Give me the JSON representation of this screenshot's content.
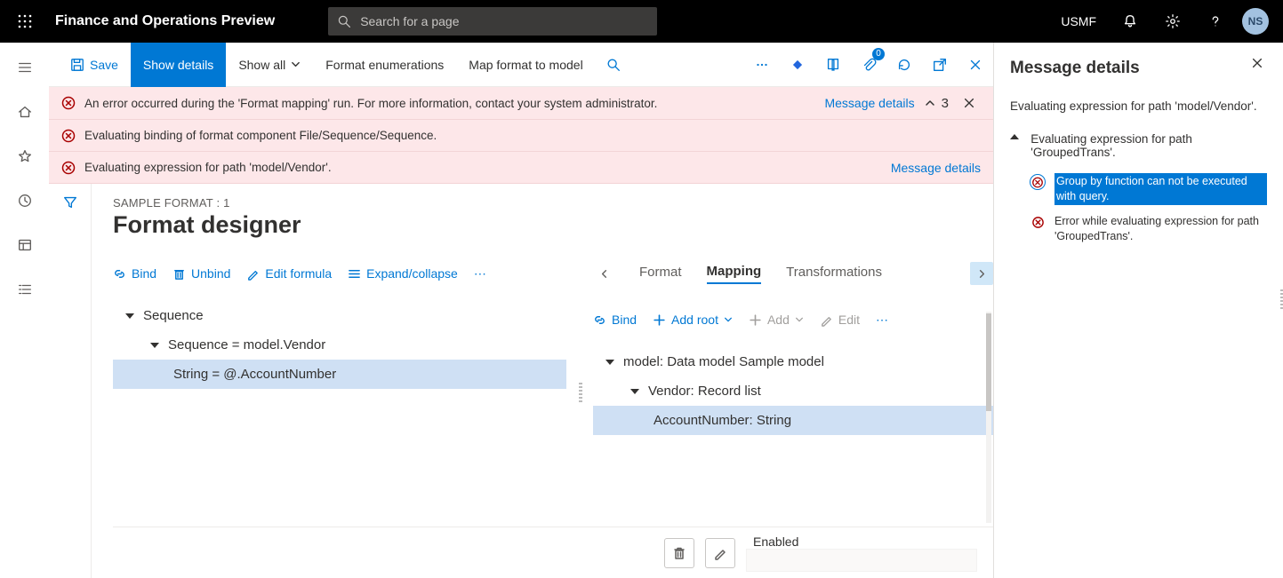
{
  "appbar": {
    "title": "Finance and Operations Preview",
    "search_placeholder": "Search for a page",
    "company": "USMF",
    "avatar": "NS"
  },
  "actionbar": {
    "save": "Save",
    "show_details": "Show details",
    "show_all": "Show all",
    "format_enum": "Format enumerations",
    "map_format": "Map format to model",
    "attach_badge": "0"
  },
  "errors": {
    "e1": "An error occurred during the 'Format mapping' run. For more information, contact your system administrator.",
    "e2": "Evaluating binding of format component File/Sequence/Sequence.",
    "e3": "Evaluating expression for path 'model/Vendor'.",
    "msg_details": "Message details",
    "count": "3"
  },
  "designer": {
    "breadcrumb": "SAMPLE FORMAT : 1",
    "title": "Format designer",
    "cmd_bind": "Bind",
    "cmd_unbind": "Unbind",
    "cmd_edit_formula": "Edit formula",
    "cmd_expand": "Expand/collapse",
    "tree_left": {
      "n1": "Sequence",
      "n2": "Sequence = model.Vendor",
      "n3": "String = @.AccountNumber"
    },
    "tabs": {
      "format": "Format",
      "mapping": "Mapping",
      "transformations": "Transformations"
    },
    "cmd_bind_r": "Bind",
    "cmd_add_root": "Add root",
    "cmd_add": "Add",
    "cmd_edit": "Edit",
    "tree_right": {
      "n1": "model: Data model Sample model",
      "n2": "Vendor: Record list",
      "n3": "AccountNumber: String"
    },
    "enabled": "Enabled"
  },
  "msgpanel": {
    "title": "Message details",
    "subtitle": "Evaluating expression for path 'model/Vendor'.",
    "group": "Evaluating expression for path 'GroupedTrans'.",
    "items": {
      "i1": "Group by function can not be executed with query.",
      "i2": "Error while evaluating expression for path 'GroupedTrans'."
    }
  }
}
